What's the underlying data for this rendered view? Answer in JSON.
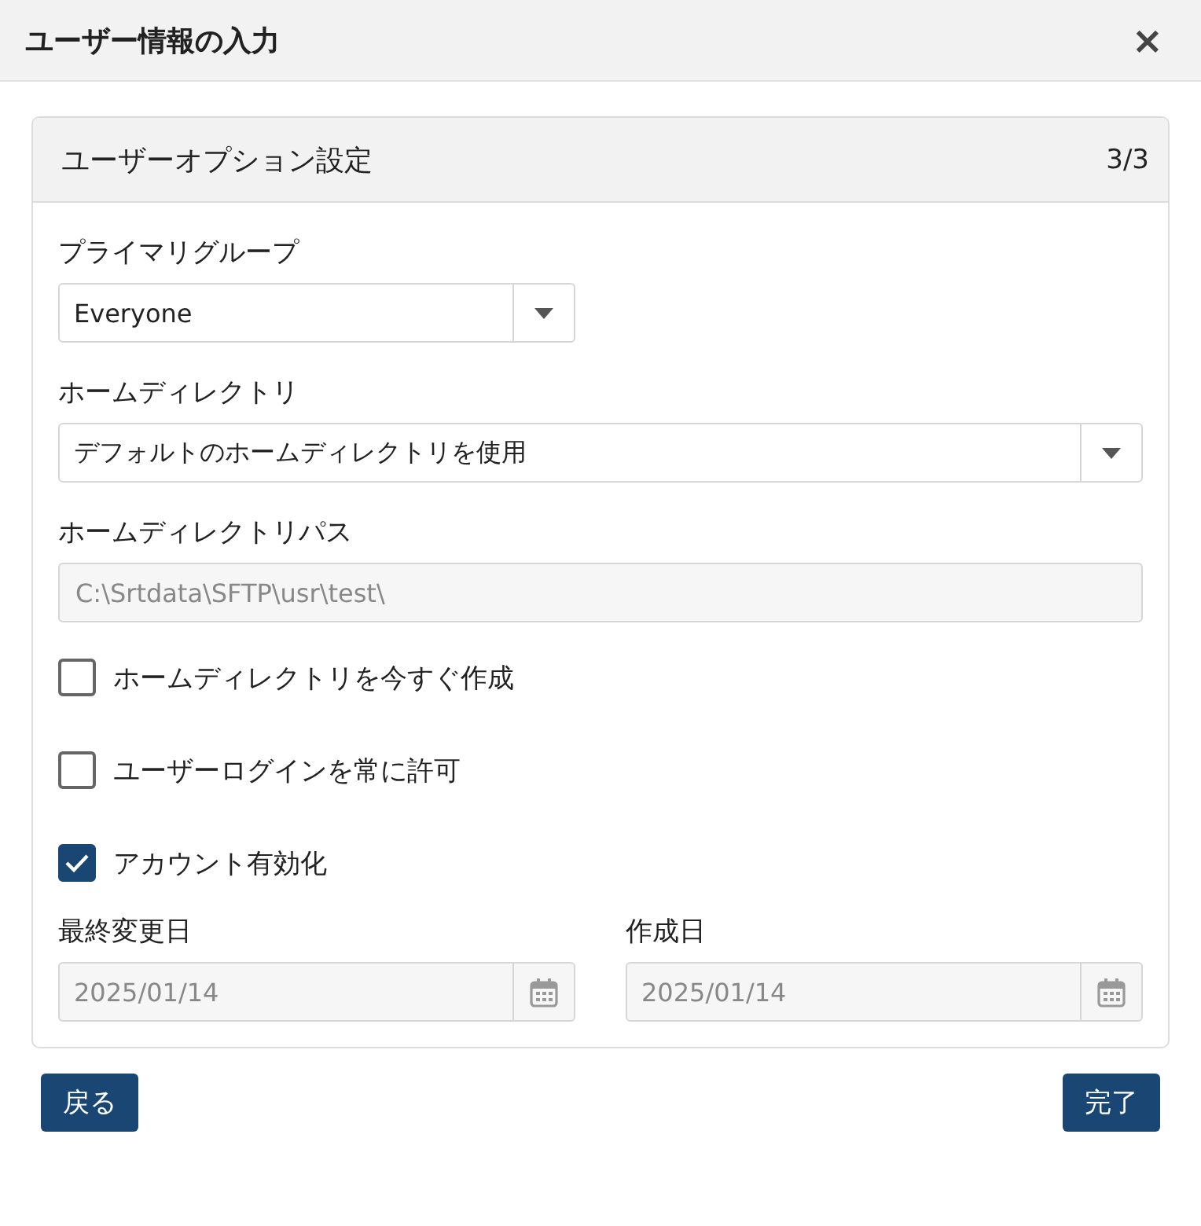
{
  "dialog": {
    "title": "ユーザー情報の入力",
    "close": "×"
  },
  "card": {
    "title": "ユーザーオプション設定",
    "step": "3/3"
  },
  "fields": [
    {
      "kind": "select",
      "label": "プライマリグループ",
      "value": "Everyone",
      "compact": true,
      "disabled": false
    },
    {
      "kind": "select",
      "label": "ホームディレクトリ",
      "value": "デフォルトのホームディレクトリを使用",
      "compact": false,
      "disabled": false
    },
    {
      "kind": "text",
      "label": "ホームディレクトリパス",
      "value": "C:\\Srtdata\\SFTP\\usr\\test\\",
      "compact": false,
      "disabled": true
    },
    {
      "kind": "checkbox",
      "label": "ホームディレクトリを今すぐ作成",
      "checked": false
    },
    {
      "kind": "checkbox",
      "label": "ユーザーログインを常に許可",
      "checked": false
    },
    {
      "kind": "checkbox",
      "label": "アカウント有効化",
      "checked": true
    }
  ],
  "dates": [
    {
      "label": "最終変更日",
      "value": "2025/01/14",
      "disabled": true
    },
    {
      "label": "作成日",
      "value": "2025/01/14",
      "disabled": true
    }
  ],
  "buttons": {
    "back": "戻る",
    "finish": "完了"
  }
}
